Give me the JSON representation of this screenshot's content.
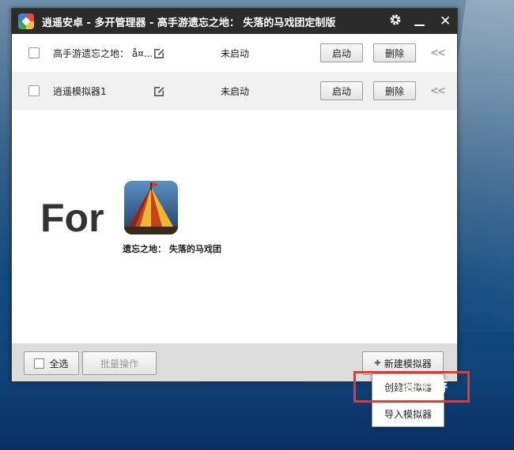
{
  "window": {
    "title": "逍遥安卓 - 多开管理器  - 高手游遗忘之地： 失落的马戏团定制版",
    "settings_icon": "gear-icon",
    "minimize_icon": "minimize-icon",
    "close_icon": "close-icon",
    "close_glyph": "✕"
  },
  "instances": [
    {
      "name": "高手游遗忘之地： å¤...",
      "status": "未启动",
      "start_label": "启动",
      "delete_label": "删除",
      "expand": "<<"
    },
    {
      "name": "逍遥模拟器1",
      "status": "未启动",
      "start_label": "启动",
      "delete_label": "删除",
      "expand": "<<"
    }
  ],
  "promo": {
    "for_text": "For",
    "game_name": "遗忘之地： 失落的马戏团"
  },
  "footer": {
    "select_all_label": "全选",
    "batch_label": "批量操作",
    "new_emulator_label": "新建模拟器",
    "plus_glyph": "✚"
  },
  "dropdown": {
    "items": [
      "创建模拟器",
      "导入模拟器"
    ]
  },
  "watermark": {
    "main": "高手游",
    "sub": "GAOSHOUYOU.COM"
  },
  "colors": {
    "titlebar": "#2b2b2b",
    "highlight": "#e53935",
    "footer": "#dcdcdc"
  }
}
